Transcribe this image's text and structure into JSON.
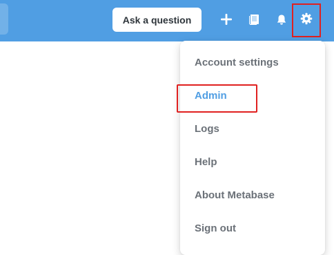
{
  "navbar": {
    "background_color": "#509ee3",
    "ask_question_label": "Ask a question",
    "icons": {
      "new": "plus-icon",
      "collection": "collection-icon",
      "notifications": "bell-icon",
      "settings": "gear-icon"
    }
  },
  "settings_menu": {
    "items": [
      {
        "label": "Account settings",
        "active": false
      },
      {
        "label": "Admin",
        "active": true
      },
      {
        "label": "Logs",
        "active": false
      },
      {
        "label": "Help",
        "active": false
      },
      {
        "label": "About Metabase",
        "active": false
      },
      {
        "label": "Sign out",
        "active": false
      }
    ],
    "accent_color": "#509ee3",
    "text_color": "#6b7178"
  },
  "annotation": {
    "highlight_color": "#e0201f"
  }
}
